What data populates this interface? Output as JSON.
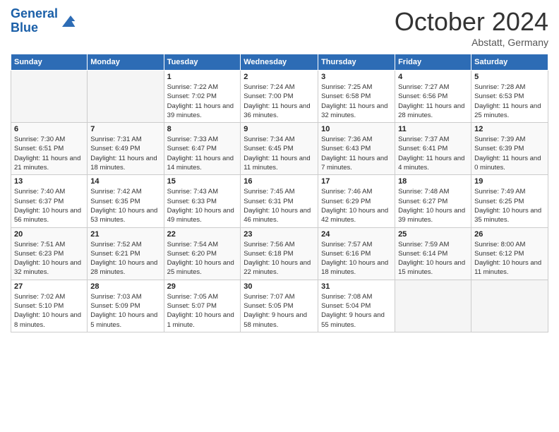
{
  "logo": {
    "line1": "General",
    "line2": "Blue"
  },
  "title": "October 2024",
  "location": "Abstatt, Germany",
  "days_of_week": [
    "Sunday",
    "Monday",
    "Tuesday",
    "Wednesday",
    "Thursday",
    "Friday",
    "Saturday"
  ],
  "weeks": [
    [
      {
        "num": "",
        "info": ""
      },
      {
        "num": "",
        "info": ""
      },
      {
        "num": "1",
        "info": "Sunrise: 7:22 AM\nSunset: 7:02 PM\nDaylight: 11 hours and 39 minutes."
      },
      {
        "num": "2",
        "info": "Sunrise: 7:24 AM\nSunset: 7:00 PM\nDaylight: 11 hours and 36 minutes."
      },
      {
        "num": "3",
        "info": "Sunrise: 7:25 AM\nSunset: 6:58 PM\nDaylight: 11 hours and 32 minutes."
      },
      {
        "num": "4",
        "info": "Sunrise: 7:27 AM\nSunset: 6:56 PM\nDaylight: 11 hours and 28 minutes."
      },
      {
        "num": "5",
        "info": "Sunrise: 7:28 AM\nSunset: 6:53 PM\nDaylight: 11 hours and 25 minutes."
      }
    ],
    [
      {
        "num": "6",
        "info": "Sunrise: 7:30 AM\nSunset: 6:51 PM\nDaylight: 11 hours and 21 minutes."
      },
      {
        "num": "7",
        "info": "Sunrise: 7:31 AM\nSunset: 6:49 PM\nDaylight: 11 hours and 18 minutes."
      },
      {
        "num": "8",
        "info": "Sunrise: 7:33 AM\nSunset: 6:47 PM\nDaylight: 11 hours and 14 minutes."
      },
      {
        "num": "9",
        "info": "Sunrise: 7:34 AM\nSunset: 6:45 PM\nDaylight: 11 hours and 11 minutes."
      },
      {
        "num": "10",
        "info": "Sunrise: 7:36 AM\nSunset: 6:43 PM\nDaylight: 11 hours and 7 minutes."
      },
      {
        "num": "11",
        "info": "Sunrise: 7:37 AM\nSunset: 6:41 PM\nDaylight: 11 hours and 4 minutes."
      },
      {
        "num": "12",
        "info": "Sunrise: 7:39 AM\nSunset: 6:39 PM\nDaylight: 11 hours and 0 minutes."
      }
    ],
    [
      {
        "num": "13",
        "info": "Sunrise: 7:40 AM\nSunset: 6:37 PM\nDaylight: 10 hours and 56 minutes."
      },
      {
        "num": "14",
        "info": "Sunrise: 7:42 AM\nSunset: 6:35 PM\nDaylight: 10 hours and 53 minutes."
      },
      {
        "num": "15",
        "info": "Sunrise: 7:43 AM\nSunset: 6:33 PM\nDaylight: 10 hours and 49 minutes."
      },
      {
        "num": "16",
        "info": "Sunrise: 7:45 AM\nSunset: 6:31 PM\nDaylight: 10 hours and 46 minutes."
      },
      {
        "num": "17",
        "info": "Sunrise: 7:46 AM\nSunset: 6:29 PM\nDaylight: 10 hours and 42 minutes."
      },
      {
        "num": "18",
        "info": "Sunrise: 7:48 AM\nSunset: 6:27 PM\nDaylight: 10 hours and 39 minutes."
      },
      {
        "num": "19",
        "info": "Sunrise: 7:49 AM\nSunset: 6:25 PM\nDaylight: 10 hours and 35 minutes."
      }
    ],
    [
      {
        "num": "20",
        "info": "Sunrise: 7:51 AM\nSunset: 6:23 PM\nDaylight: 10 hours and 32 minutes."
      },
      {
        "num": "21",
        "info": "Sunrise: 7:52 AM\nSunset: 6:21 PM\nDaylight: 10 hours and 28 minutes."
      },
      {
        "num": "22",
        "info": "Sunrise: 7:54 AM\nSunset: 6:20 PM\nDaylight: 10 hours and 25 minutes."
      },
      {
        "num": "23",
        "info": "Sunrise: 7:56 AM\nSunset: 6:18 PM\nDaylight: 10 hours and 22 minutes."
      },
      {
        "num": "24",
        "info": "Sunrise: 7:57 AM\nSunset: 6:16 PM\nDaylight: 10 hours and 18 minutes."
      },
      {
        "num": "25",
        "info": "Sunrise: 7:59 AM\nSunset: 6:14 PM\nDaylight: 10 hours and 15 minutes."
      },
      {
        "num": "26",
        "info": "Sunrise: 8:00 AM\nSunset: 6:12 PM\nDaylight: 10 hours and 11 minutes."
      }
    ],
    [
      {
        "num": "27",
        "info": "Sunrise: 7:02 AM\nSunset: 5:10 PM\nDaylight: 10 hours and 8 minutes."
      },
      {
        "num": "28",
        "info": "Sunrise: 7:03 AM\nSunset: 5:09 PM\nDaylight: 10 hours and 5 minutes."
      },
      {
        "num": "29",
        "info": "Sunrise: 7:05 AM\nSunset: 5:07 PM\nDaylight: 10 hours and 1 minute."
      },
      {
        "num": "30",
        "info": "Sunrise: 7:07 AM\nSunset: 5:05 PM\nDaylight: 9 hours and 58 minutes."
      },
      {
        "num": "31",
        "info": "Sunrise: 7:08 AM\nSunset: 5:04 PM\nDaylight: 9 hours and 55 minutes."
      },
      {
        "num": "",
        "info": ""
      },
      {
        "num": "",
        "info": ""
      }
    ]
  ]
}
